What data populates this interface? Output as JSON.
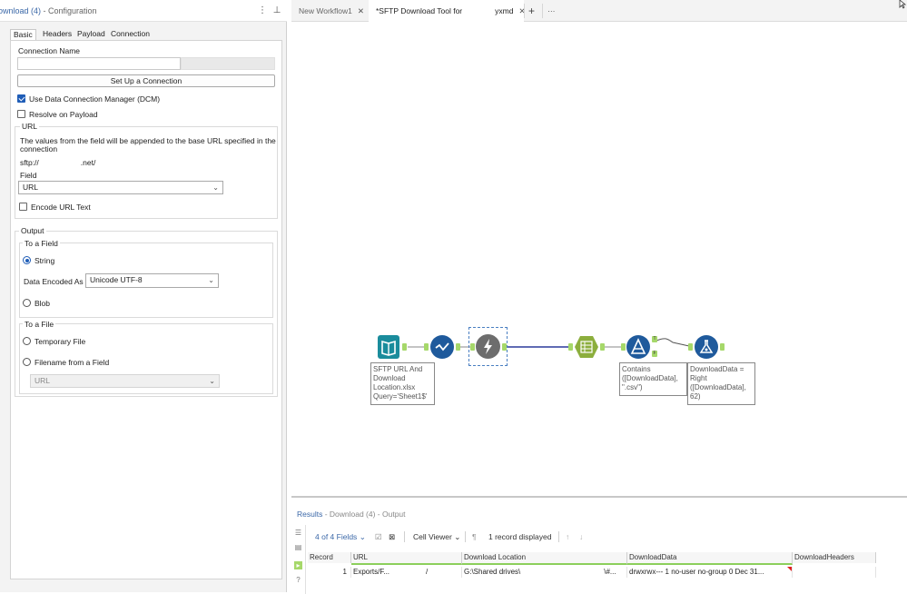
{
  "config": {
    "title_tool": "ownload (4)",
    "title_rest": " - Configuration",
    "menu_glyph": "⋮",
    "pin_glyph": "⊥",
    "tabs": [
      "Basic",
      "Headers",
      "Payload",
      "Connection"
    ],
    "connection_name_label": "Connection Name",
    "setup_button": "Set Up a Connection",
    "use_dcm_label": "Use Data Connection Manager (DCM)",
    "resolve_payload_label": "Resolve on Payload",
    "url_group_label": "URL",
    "url_help_line1": "The values from the field will be appended to the base URL specified in the",
    "url_help_line2": "connection",
    "base_url_prefix": "sftp://",
    "base_url_suffix": ".net/",
    "field_label": "Field",
    "field_value": "URL",
    "encode_url_label": "Encode URL Text",
    "output_label": "Output",
    "to_field_label": "To a Field",
    "string_label": "String",
    "encoded_as_label": "Data Encoded As",
    "encoded_as_value": "Unicode UTF-8",
    "blob_label": "Blob",
    "to_file_label": "To a File",
    "temp_file_label": "Temporary File",
    "filename_field_label": "Filename from a Field",
    "filename_field_value": "URL"
  },
  "doc_tabs": {
    "tab1": "New Workflow1",
    "tab2_a": "*SFTP Download Tool for",
    "tab2_b": "yxmd",
    "close": "✕",
    "add": "+",
    "more": "···"
  },
  "canvas": {
    "input_label": "SFTP URL And\nDownload\nLocation.xlsx\nQuery='Sheet1$'",
    "filter_label": "Contains\n([DownloadData],\n\".csv\")",
    "formula_label": "DownloadData =\nRight\n([DownloadData],\n62)",
    "filter_true": "T",
    "filter_false": "F"
  },
  "results": {
    "title_main": "Results",
    "title_rest": " - Download (4) - Output",
    "fields": "4 of 4 Fields",
    "cell_viewer": "Cell Viewer",
    "records": "1 record displayed",
    "columns": [
      "Record",
      "URL",
      "Download Location",
      "DownloadData",
      "DownloadHeaders"
    ],
    "row": {
      "record": "1",
      "url": "Exports/F...",
      "url_tail": "/",
      "location": "G:\\Shared drives\\",
      "location_tail": "\\#...",
      "data": "drwxrwx---   1 no-user  no-group         0 Dec 31...",
      "headers": ""
    }
  },
  "colors": {
    "accent": "#1f5db7",
    "tool_teal": "#1a8c9c",
    "tool_blue": "#1f5a9c",
    "tool_grey": "#6d6d6d",
    "tool_green": "#8cae3d",
    "connector": "#2b3a9c"
  }
}
